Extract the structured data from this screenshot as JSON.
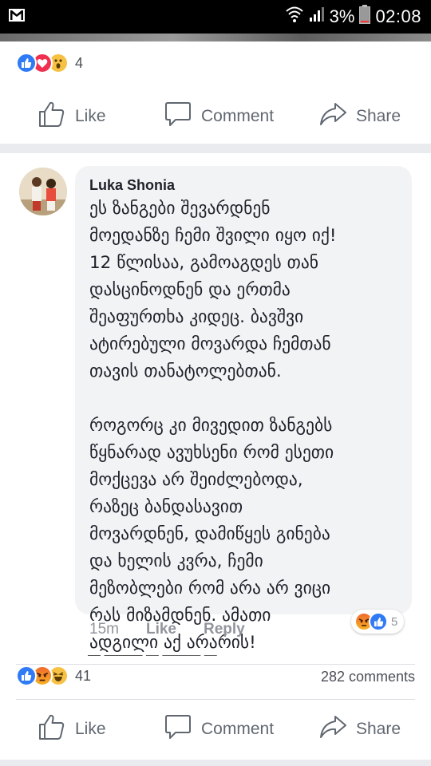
{
  "status_bar": {
    "battery": "3%",
    "time": "02:08",
    "icons": [
      "gmail-icon",
      "wifi-icon",
      "signal-icon",
      "battery-icon"
    ]
  },
  "post1": {
    "reactions": [
      "like",
      "love",
      "wow"
    ],
    "reaction_count": "4",
    "actions": {
      "like": "Like",
      "comment": "Comment",
      "share": "Share"
    }
  },
  "post2": {
    "comment": {
      "author": "Luka Shonia",
      "text": "ეს ზანგები შევარდნენ\nმოედანზე ჩემი შვილი იყო იქ!\n12 წლისაა, გამოაგდეს თან\nდასცინოდნენ და ერთმა\nშეაფურთხა კიდეც. ბავშვი\nატირებული მოვარდა ჩემთან\nთავის თანატოლებთან.\n\nროგორც კი მივედით ზანგებს\nწყნარად ავუხსენი რომ ესეთი\nმოქცევა არ შეიძლებოდა,\nრაზეც ბანდასავით\nმოვარდნენ, დამიწყეს გინება\nდა ხელის კვრა, ჩემი\nმეზობლები რომ არა არ ვიცი\nრას მიზამდნენ. ამათი\nადგილი აქ არარის!",
      "time": "15m",
      "like_label": "Like",
      "reply_label": "Reply",
      "reactions": [
        "angry",
        "like"
      ],
      "reaction_count": "5"
    },
    "reactions": [
      "like",
      "angry",
      "haha"
    ],
    "reaction_count": "41",
    "comments_count": "282 comments",
    "actions": {
      "like": "Like",
      "comment": "Comment",
      "share": "Share"
    }
  },
  "colors": {
    "like_blue": "#2f7bf5",
    "love_red": "#f0304f",
    "haha_yellow": "#f7c244",
    "text_gray": "#606770"
  }
}
